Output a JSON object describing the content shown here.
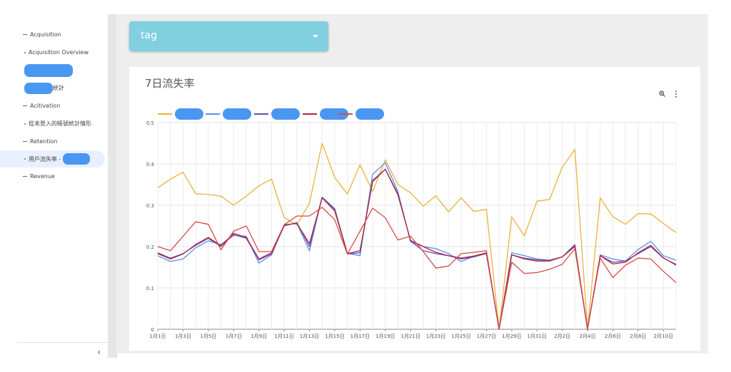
{
  "sidebar": {
    "items": [
      {
        "label": "Acquisition",
        "level": "top"
      },
      {
        "label": "Acquisition Overview",
        "level": "sub"
      },
      {
        "label": "",
        "level": "redacted"
      },
      {
        "label": "統計",
        "level": "redacted-suffix"
      },
      {
        "label": "Acitivation",
        "level": "top"
      },
      {
        "label": "從未登入的帳號統計情形",
        "level": "sub"
      },
      {
        "label": "Retention",
        "level": "top"
      },
      {
        "label": "用戶流失率 -",
        "level": "sub-active"
      },
      {
        "label": "Revenue",
        "level": "top"
      }
    ],
    "collapse_icon": "‹"
  },
  "filter": {
    "label": "tag"
  },
  "card": {
    "title": "7日流失率"
  },
  "colors": {
    "selector": "#80d0e0",
    "redaction": "#4a97f2",
    "series": [
      "#e8b33a",
      "#5b8def",
      "#6a4fb5",
      "#b0263a",
      "#d64b4b"
    ]
  },
  "chart_data": {
    "type": "line",
    "title": "7日流失率",
    "ylim": [
      0,
      0.5
    ],
    "yticks": [
      "0",
      "0.1",
      "0.2",
      "0.3",
      "0.4",
      "0.5"
    ],
    "x_labels": [
      "1月1日",
      "1月3日",
      "1月5日",
      "1月7日",
      "1月9日",
      "1月11日",
      "1月13日",
      "1月15日",
      "1月17日",
      "1月19日",
      "1月21日",
      "1月23日",
      "1月25日",
      "1月27日",
      "1月29日",
      "1月31日",
      "2月2日",
      "2月4日",
      "2月6日",
      "2月8日",
      "2月10日"
    ],
    "grid": true,
    "legend_position": "top-left",
    "series": [
      {
        "values": [
          0.342,
          0.363,
          0.38,
          0.328,
          0.326,
          0.322,
          0.3,
          0.322,
          0.347,
          0.363,
          0.27,
          0.253,
          0.305,
          0.45,
          0.367,
          0.327,
          0.398,
          0.333,
          0.41,
          0.35,
          0.33,
          0.298,
          0.323,
          0.284,
          0.318,
          0.285,
          0.29,
          0,
          0.272,
          0.226,
          0.31,
          0.314,
          0.392,
          0.435,
          0,
          0.318,
          0.272,
          0.254,
          0.28,
          0.279,
          0.256,
          0.234
        ]
      },
      {
        "values": [
          0.178,
          0.164,
          0.17,
          0.197,
          0.214,
          0.205,
          0.227,
          0.225,
          0.16,
          0.18,
          0.253,
          0.256,
          0.19,
          0.32,
          0.292,
          0.184,
          0.178,
          0.375,
          0.403,
          0.333,
          0.212,
          0.2,
          0.195,
          0.183,
          0.164,
          0.176,
          0.184,
          0,
          0.185,
          0.178,
          0.17,
          0.167,
          0.175,
          0.205,
          0,
          0.18,
          0.17,
          0.165,
          0.193,
          0.213,
          0.178,
          0.167
        ]
      },
      {
        "values": [
          0.185,
          0.172,
          0.183,
          0.203,
          0.22,
          0.2,
          0.229,
          0.22,
          0.168,
          0.182,
          0.25,
          0.258,
          0.2,
          0.318,
          0.29,
          0.182,
          0.185,
          0.36,
          0.387,
          0.328,
          0.213,
          0.19,
          0.183,
          0.178,
          0.17,
          0.175,
          0.183,
          0,
          0.18,
          0.172,
          0.168,
          0.167,
          0.175,
          0.2,
          0,
          0.178,
          0.162,
          0.165,
          0.183,
          0.2,
          0.172,
          0.157
        ]
      },
      {
        "values": [
          0.183,
          0.17,
          0.182,
          0.205,
          0.222,
          0.202,
          0.232,
          0.222,
          0.17,
          0.185,
          0.252,
          0.256,
          0.207,
          0.318,
          0.286,
          0.183,
          0.19,
          0.357,
          0.387,
          0.325,
          0.215,
          0.2,
          0.186,
          0.178,
          0.172,
          0.177,
          0.185,
          0,
          0.18,
          0.17,
          0.165,
          0.165,
          0.175,
          0.203,
          0,
          0.178,
          0.158,
          0.162,
          0.185,
          0.203,
          0.173,
          0.155
        ]
      },
      {
        "values": [
          0.2,
          0.19,
          0.225,
          0.26,
          0.254,
          0.192,
          0.237,
          0.25,
          0.188,
          0.188,
          0.253,
          0.274,
          0.274,
          0.295,
          0.265,
          0.182,
          0.237,
          0.293,
          0.27,
          0.216,
          0.225,
          0.188,
          0.148,
          0.153,
          0.183,
          0.186,
          0.19,
          0,
          0.162,
          0.135,
          0.137,
          0.145,
          0.157,
          0.195,
          0,
          0.172,
          0.125,
          0.155,
          0.172,
          0.17,
          0.14,
          0.113
        ]
      }
    ]
  }
}
